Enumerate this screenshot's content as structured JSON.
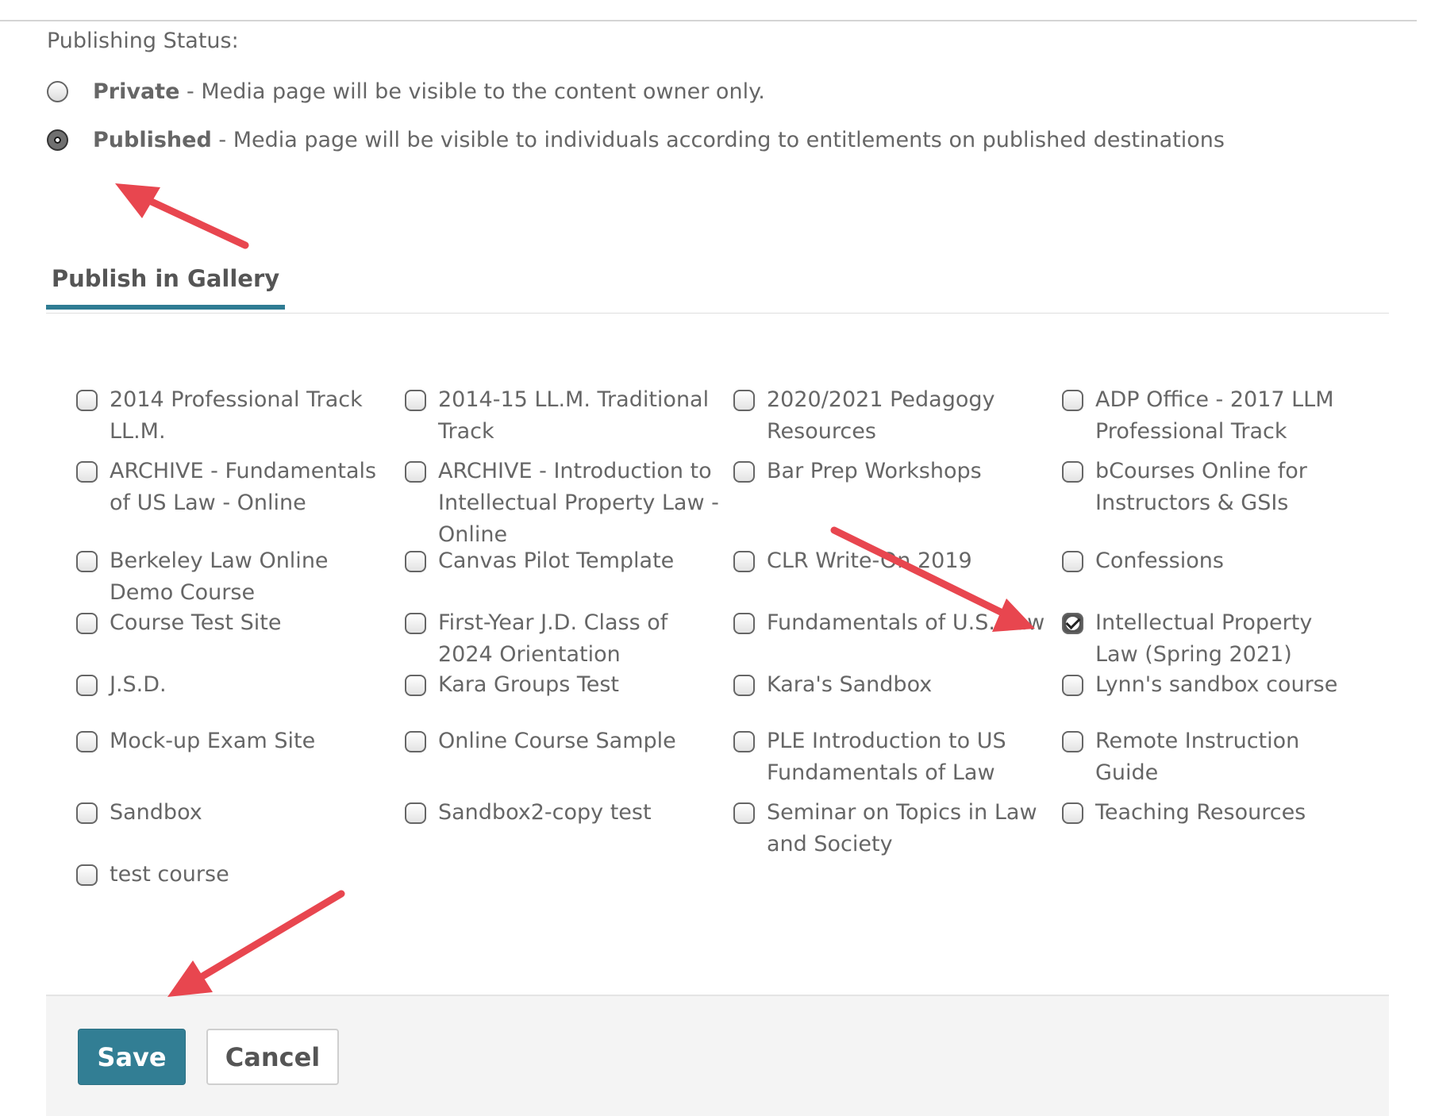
{
  "publishing": {
    "label": "Publishing Status:",
    "options": [
      {
        "title": "Private",
        "desc": " - Media page will be visible to the content owner only.",
        "selected": false
      },
      {
        "title": "Published",
        "desc": " - Media page will be visible to individuals according to entitlements on published destinations",
        "selected": true
      }
    ]
  },
  "tab": {
    "label": "Publish in Gallery"
  },
  "galleries": [
    {
      "label": "2014 Professional Track LL.M.",
      "checked": false
    },
    {
      "label": "2014-15 LL.M. Traditional Track",
      "checked": false
    },
    {
      "label": "2020/2021 Pedagogy Resources",
      "checked": false
    },
    {
      "label": "ADP Office - 2017 LLM Professional Track",
      "checked": false
    },
    {
      "label": "ARCHIVE - Fundamentals of US Law - Online",
      "checked": false
    },
    {
      "label": "ARCHIVE - Introduction to Intellectual Property Law - Online",
      "checked": false
    },
    {
      "label": "Bar Prep Workshops",
      "checked": false
    },
    {
      "label": "bCourses Online for Instructors & GSIs",
      "checked": false
    },
    {
      "label": "Berkeley Law Online Demo Course",
      "checked": false
    },
    {
      "label": "Canvas Pilot Template",
      "checked": false
    },
    {
      "label": "CLR Write-On 2019",
      "checked": false
    },
    {
      "label": "Confessions",
      "checked": false
    },
    {
      "label": "Course Test Site",
      "checked": false
    },
    {
      "label": "First-Year J.D. Class of 2024 Orientation",
      "checked": false
    },
    {
      "label": "Fundamentals of U.S. Law",
      "checked": false
    },
    {
      "label": "Intellectual Property Law (Spring 2021)",
      "checked": true
    },
    {
      "label": "J.S.D.",
      "checked": false
    },
    {
      "label": "Kara Groups Test",
      "checked": false
    },
    {
      "label": "Kara's Sandbox",
      "checked": false
    },
    {
      "label": "Lynn's sandbox course",
      "checked": false
    },
    {
      "label": "Mock-up Exam Site",
      "checked": false
    },
    {
      "label": "Online Course Sample",
      "checked": false
    },
    {
      "label": "PLE Introduction to US Fundamentals of Law",
      "checked": false
    },
    {
      "label": "Remote Instruction Guide",
      "checked": false
    },
    {
      "label": "Sandbox",
      "checked": false
    },
    {
      "label": "Sandbox2-copy test",
      "checked": false
    },
    {
      "label": "Seminar on Topics in Law and Society",
      "checked": false
    },
    {
      "label": "Teaching Resources",
      "checked": false
    },
    {
      "label": "test course",
      "checked": false
    }
  ],
  "footer": {
    "save_label": "Save",
    "cancel_label": "Cancel"
  },
  "colors": {
    "accent": "#327e94",
    "arrow": "#e8464f"
  }
}
